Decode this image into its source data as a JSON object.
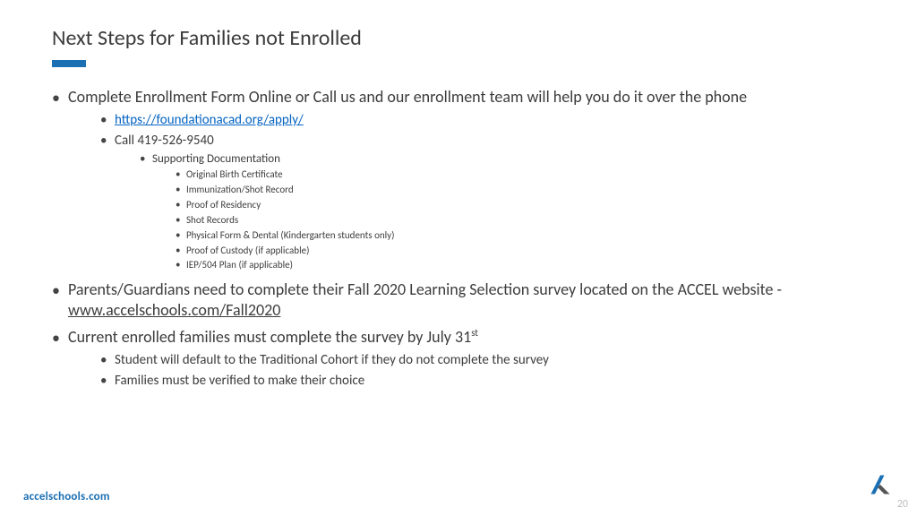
{
  "title": "Next Steps for Families not Enrolled",
  "b1": {
    "item1": "Complete Enrollment Form Online or Call us and our enrollment team will help you do it over the phone",
    "item1_link": "https://foundationacad.org/apply/",
    "item1_call": "Call 419-526-9540",
    "item1_docs_header": "Supporting Documentation",
    "docs": {
      "d1": "Original Birth Certificate",
      "d2": "Immunization/Shot Record",
      "d3": "Proof of Residency",
      "d4": "Shot Records",
      "d5": "Physical Form & Dental (Kindergarten students only)",
      "d6": "Proof of Custody (if applicable)",
      "d7": "IEP/504 Plan (if applicable)"
    },
    "item2_pre": "Parents/Guardians need to complete their Fall 2020 Learning Selection survey located on the ACCEL website - ",
    "item2_link": "www.accelschools.com/Fall2020",
    "item3_pre": "Current enrolled families must complete the survey by July 31",
    "item3_sup": "st",
    "item3_sub1": "Student will default to the Traditional Cohort if they do not complete the survey",
    "item3_sub2": "Families must be verified to make their choice"
  },
  "footer_url": "accelschools.com",
  "page_number": "20"
}
